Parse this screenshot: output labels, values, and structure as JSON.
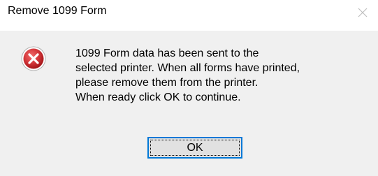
{
  "window": {
    "title": "Remove 1099 Form",
    "close_icon": "close-icon"
  },
  "message": {
    "icon": "error-icon",
    "lines": [
      "1099 Form data has been sent to the",
      "selected printer. When all forms have printed,",
      "please remove them from the printer.",
      "When ready click OK to continue."
    ]
  },
  "buttons": {
    "ok_label": "OK"
  },
  "colors": {
    "accent": "#0078d7",
    "error_red": "#d13438",
    "dialog_bg": "#f0f0f0"
  }
}
